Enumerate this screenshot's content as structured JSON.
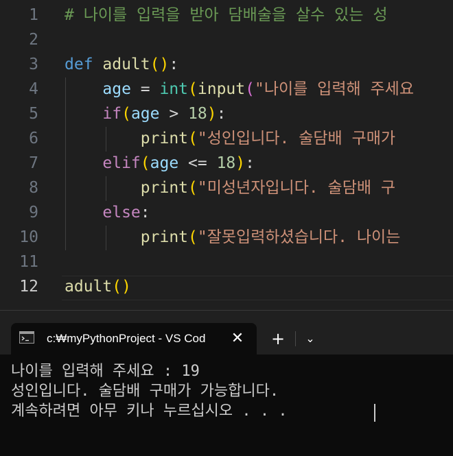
{
  "editor": {
    "lines": [
      {
        "n": "1",
        "tokens": [
          [
            "cm",
            "# 나이를 입력을 받아 담배술을 살수 있는 성"
          ]
        ]
      },
      {
        "n": "2",
        "tokens": []
      },
      {
        "n": "3",
        "tokens": [
          [
            "kw",
            "def "
          ],
          [
            "fn",
            "adult"
          ],
          [
            "p1",
            "("
          ],
          [
            "p1",
            ")"
          ],
          [
            "op",
            ":"
          ]
        ]
      },
      {
        "n": "4",
        "tokens": [
          [
            "op",
            "    "
          ],
          [
            "var",
            "age"
          ],
          [
            "op",
            " = "
          ],
          [
            "type",
            "int"
          ],
          [
            "p1",
            "("
          ],
          [
            "fn",
            "input"
          ],
          [
            "p2",
            "("
          ],
          [
            "str",
            "\"나이를 입력해 주세요"
          ]
        ]
      },
      {
        "n": "5",
        "tokens": [
          [
            "op",
            "    "
          ],
          [
            "ctl",
            "if"
          ],
          [
            "p1",
            "("
          ],
          [
            "var",
            "age"
          ],
          [
            "op",
            " > "
          ],
          [
            "num",
            "18"
          ],
          [
            "p1",
            ")"
          ],
          [
            "op",
            ":"
          ]
        ]
      },
      {
        "n": "6",
        "tokens": [
          [
            "op",
            "        "
          ],
          [
            "fn",
            "print"
          ],
          [
            "p1",
            "("
          ],
          [
            "str",
            "\"성인입니다. 술담배 구매가"
          ]
        ]
      },
      {
        "n": "7",
        "tokens": [
          [
            "op",
            "    "
          ],
          [
            "ctl",
            "elif"
          ],
          [
            "p1",
            "("
          ],
          [
            "var",
            "age"
          ],
          [
            "op",
            " <= "
          ],
          [
            "num",
            "18"
          ],
          [
            "p1",
            ")"
          ],
          [
            "op",
            ":"
          ]
        ]
      },
      {
        "n": "8",
        "tokens": [
          [
            "op",
            "        "
          ],
          [
            "fn",
            "print"
          ],
          [
            "p1",
            "("
          ],
          [
            "str",
            "\"미성년자입니다. 술담배 구"
          ]
        ]
      },
      {
        "n": "9",
        "tokens": [
          [
            "op",
            "    "
          ],
          [
            "ctl",
            "else"
          ],
          [
            "op",
            ":"
          ]
        ]
      },
      {
        "n": "10",
        "tokens": [
          [
            "op",
            "        "
          ],
          [
            "fn",
            "print"
          ],
          [
            "p1",
            "("
          ],
          [
            "str",
            "\"잘못입력하셨습니다. 나이는"
          ]
        ]
      },
      {
        "n": "11",
        "tokens": []
      },
      {
        "n": "12",
        "tokens": [
          [
            "fn",
            "adult"
          ],
          [
            "p1",
            "("
          ],
          [
            "p1",
            ")"
          ]
        ]
      }
    ]
  },
  "terminal": {
    "tab_title": "c:₩myPythonProject - VS Cod",
    "close_glyph": "✕",
    "new_tab_glyph": "+",
    "dropdown_glyph": "⌄",
    "output": [
      "나이를 입력해 주세요 : 19",
      "성인입니다. 술담배 구매가 가능합니다.",
      "계속하려면 아무 키나 누르십시오 . . ."
    ]
  }
}
